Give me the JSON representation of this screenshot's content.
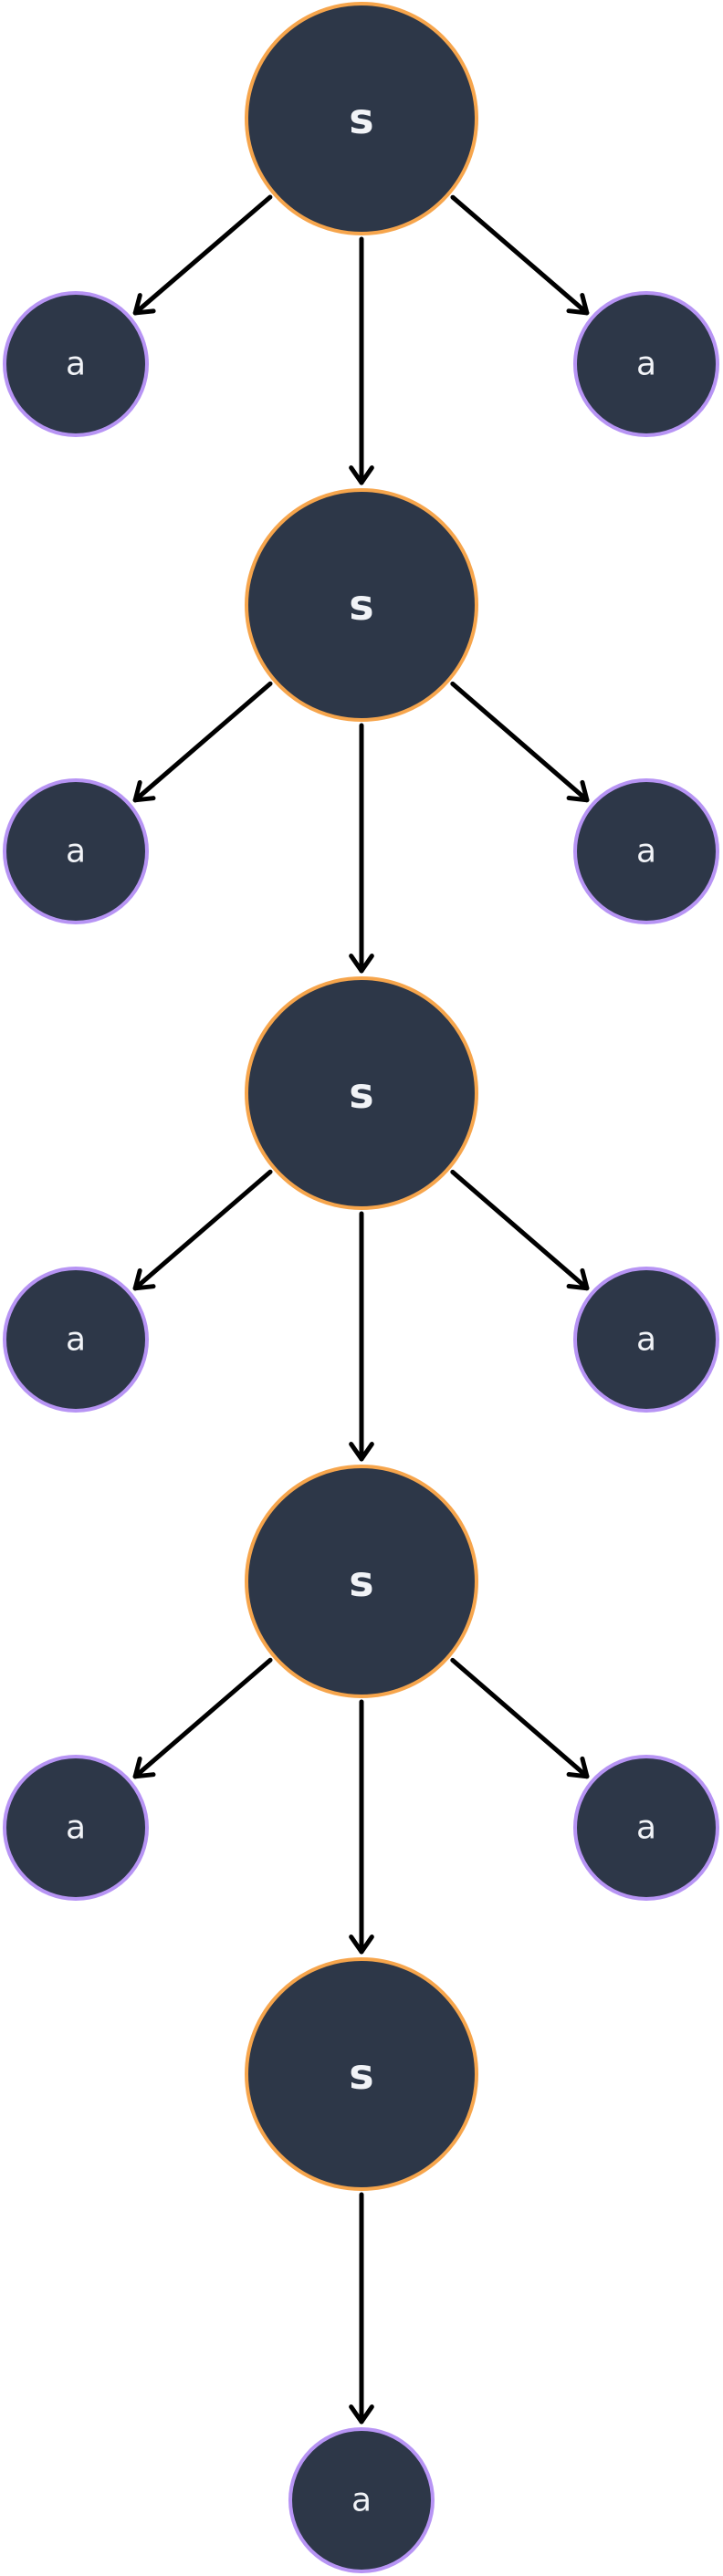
{
  "colors": {
    "node_fill": "#2d3748",
    "state_border": "#f6a54c",
    "action_border": "#b794f4",
    "edge": "#000000",
    "label": "#f1f3f7"
  },
  "diagram": {
    "states": [
      {
        "label": "s"
      },
      {
        "label": "s"
      },
      {
        "label": "s"
      },
      {
        "label": "s"
      },
      {
        "label": "s"
      }
    ],
    "actions": [
      {
        "label": "a"
      },
      {
        "label": "a"
      },
      {
        "label": "a"
      },
      {
        "label": "a"
      },
      {
        "label": "a"
      },
      {
        "label": "a"
      },
      {
        "label": "a"
      },
      {
        "label": "a"
      },
      {
        "label": "a"
      }
    ],
    "edges": [
      {
        "from": "state.0",
        "to": "action.0"
      },
      {
        "from": "state.0",
        "to": "action.1"
      },
      {
        "from": "state.0",
        "to": "state.1"
      },
      {
        "from": "state.1",
        "to": "action.2"
      },
      {
        "from": "state.1",
        "to": "action.3"
      },
      {
        "from": "state.1",
        "to": "state.2"
      },
      {
        "from": "state.2",
        "to": "action.4"
      },
      {
        "from": "state.2",
        "to": "action.5"
      },
      {
        "from": "state.2",
        "to": "state.3"
      },
      {
        "from": "state.3",
        "to": "action.6"
      },
      {
        "from": "state.3",
        "to": "action.7"
      },
      {
        "from": "state.3",
        "to": "state.4"
      },
      {
        "from": "state.4",
        "to": "action.8"
      }
    ]
  }
}
